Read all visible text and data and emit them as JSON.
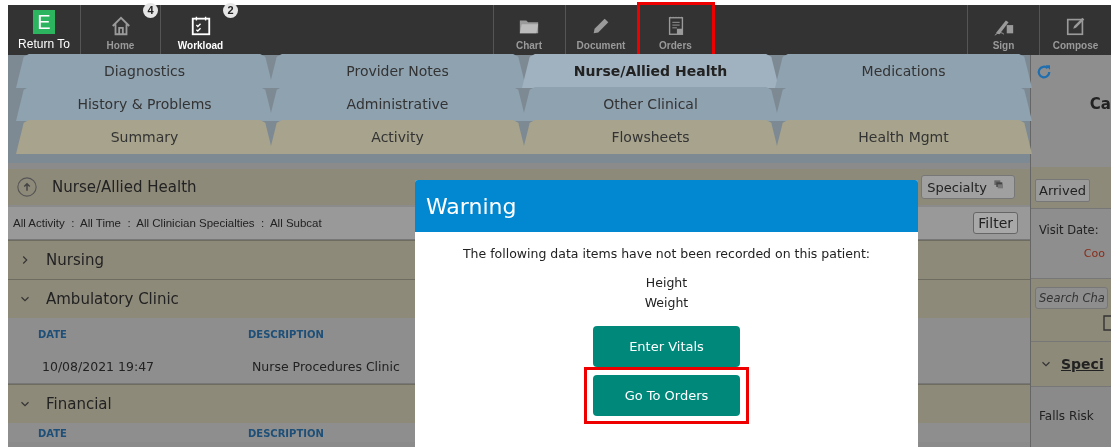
{
  "toolbar": {
    "return_item": {
      "logo": "E",
      "label": "Return To"
    },
    "items": [
      {
        "label": "Home",
        "badge": "4",
        "active": false,
        "highlighted": false
      },
      {
        "label": "Workload",
        "badge": "2",
        "active": true,
        "highlighted": false
      },
      {
        "label": "Chart",
        "active": false,
        "highlighted": false
      },
      {
        "label": "Document",
        "active": false,
        "highlighted": false
      },
      {
        "label": "Orders",
        "active": false,
        "highlighted": true
      },
      {
        "label": "Sign",
        "active": false,
        "highlighted": false
      },
      {
        "label": "Compose",
        "active": false,
        "highlighted": false
      }
    ]
  },
  "tab_rows": [
    {
      "kind": "blue",
      "tabs": [
        {
          "label": "Diagnostics",
          "selected": false
        },
        {
          "label": "Provider Notes",
          "selected": false
        },
        {
          "label": "Nurse/Allied Health",
          "selected": true
        },
        {
          "label": "Medications",
          "selected": false
        }
      ]
    },
    {
      "kind": "blue",
      "tabs": [
        {
          "label": "History & Problems",
          "selected": false
        },
        {
          "label": "Administrative",
          "selected": false
        },
        {
          "label": "Other Clinical",
          "selected": false
        },
        {
          "selected": false
        }
      ]
    },
    {
      "kind": "tan",
      "tabs": [
        {
          "label": "Summary",
          "selected": false
        },
        {
          "label": "Activity",
          "selected": false
        },
        {
          "label": "Flowsheets",
          "selected": false
        },
        {
          "label": "Health Mgmt",
          "selected": false
        }
      ]
    }
  ],
  "activity": {
    "title": "Nurse/Allied Health",
    "specialty_button": "Specialty",
    "filter_summary": "All Activity  :  All Time  :  All Clinician Specialties  :  All Subcat",
    "filter_button": "Filter",
    "sections": [
      {
        "title": "Nursing",
        "expanded": false
      },
      {
        "title": "Ambulatory Clinic",
        "expanded": true,
        "columns": [
          "DATE",
          "DESCRIPTION"
        ],
        "rows": [
          [
            "10/08/2021 19:47",
            "Nurse Procedures Clinic"
          ]
        ]
      },
      {
        "title": "Financial",
        "expanded": true,
        "columns": [
          "DATE",
          "DESCRIPTION"
        ]
      }
    ]
  },
  "side_panel": {
    "heading": "Ca",
    "status_button": "Arrived",
    "visit_date_label": "Visit Date:",
    "alert": "Coo",
    "search": {
      "placeholder": "Search Cha"
    },
    "section": {
      "title": "Speci",
      "expanded": true
    },
    "falls_risk": "Falls Risk"
  },
  "dialog": {
    "title": "Warning",
    "message": "The following data items have not been recorded on this patient:",
    "missing_items": [
      "Height",
      "Weight"
    ],
    "buttons": [
      {
        "label": "Enter Vitals",
        "highlighted": false
      },
      {
        "label": "Go To Orders",
        "highlighted": true
      }
    ]
  }
}
